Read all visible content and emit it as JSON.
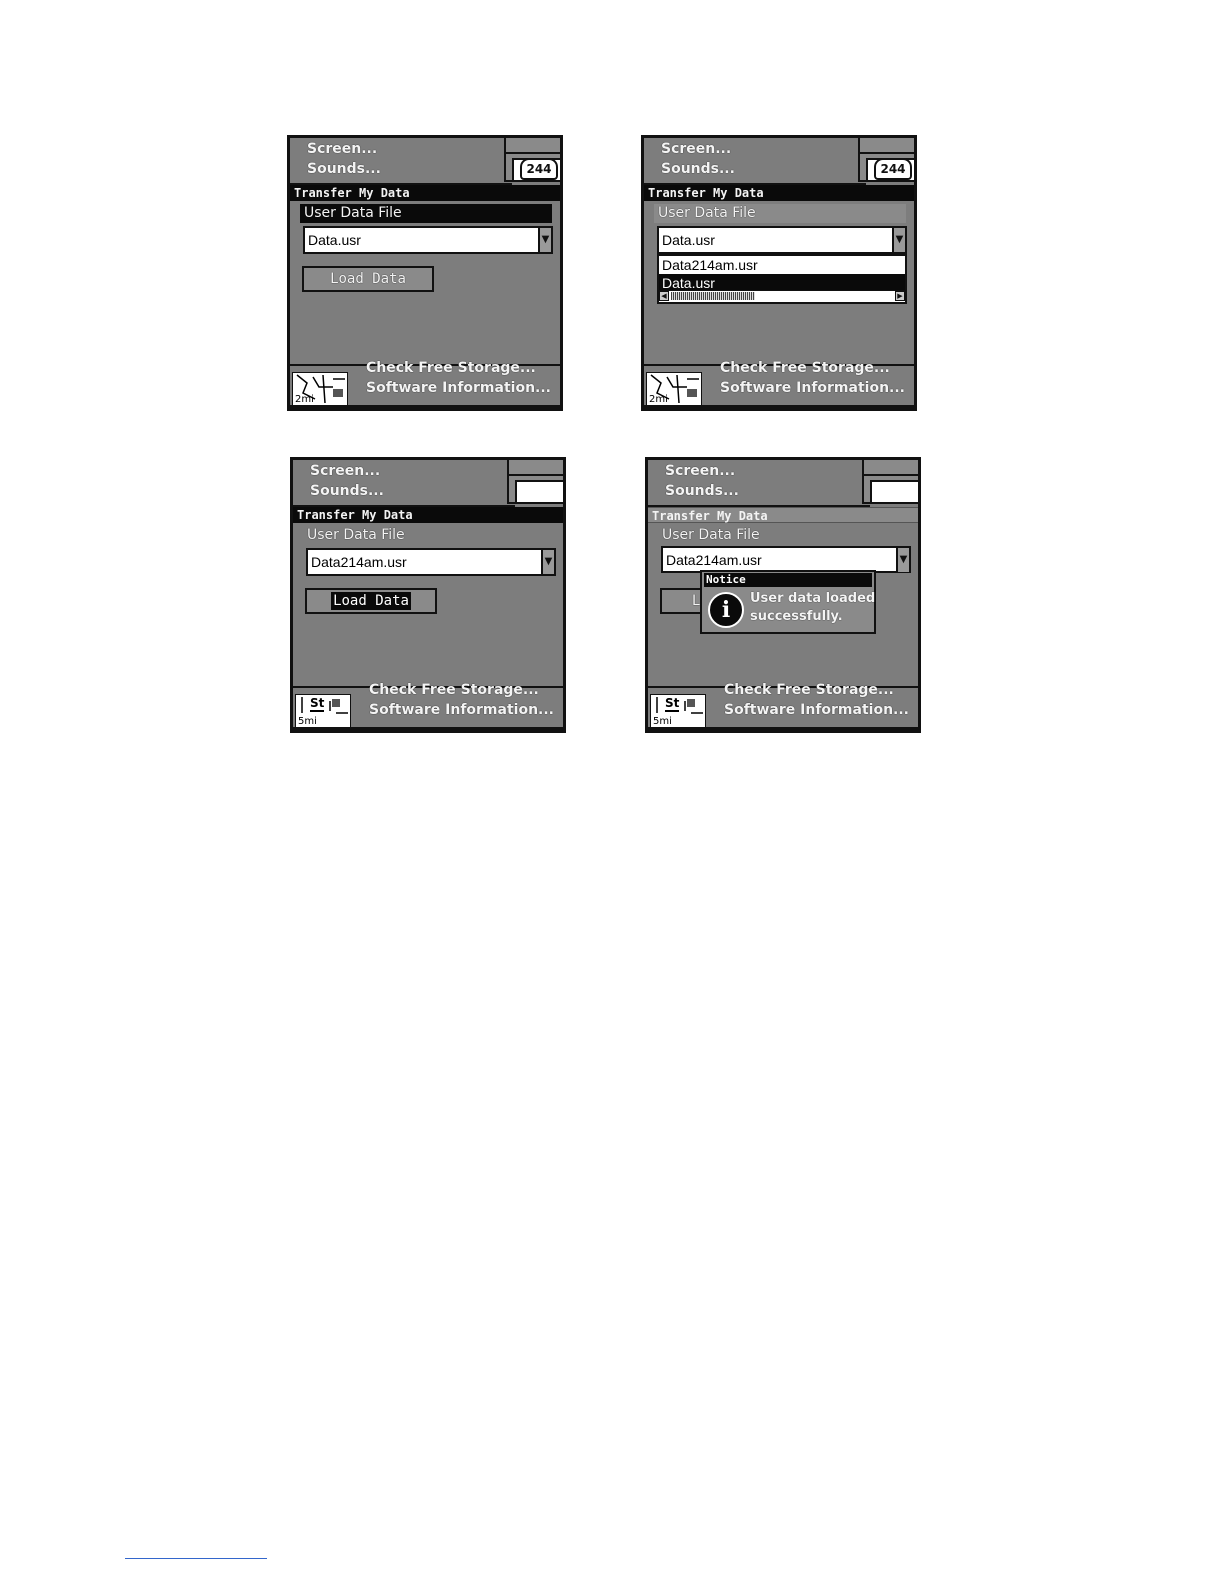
{
  "menu": {
    "screen": "Screen...",
    "sounds": "Sounds...",
    "check_free_storage": "Check Free Storage...",
    "software_information": "Software Information..."
  },
  "dialog": {
    "title": "Transfer My Data",
    "file_label": "User Data File",
    "load_button": "Load Data",
    "load_button_partial": "L"
  },
  "map": {
    "route_badge": "244",
    "scale_2mi": "2mi",
    "scale_5mi": "5mi",
    "street_label": "St"
  },
  "screens": {
    "s1": {
      "selected_file": "Data.usr"
    },
    "s2": {
      "selected_file": "Data.usr",
      "options": [
        "Data214am.usr",
        "Data.usr"
      ]
    },
    "s3": {
      "selected_file": "Data214am.usr"
    },
    "s4": {
      "selected_file": "Data214am.usr"
    }
  },
  "notice": {
    "title": "Notice",
    "message": "User data loaded successfully.",
    "icon": "info-icon"
  }
}
